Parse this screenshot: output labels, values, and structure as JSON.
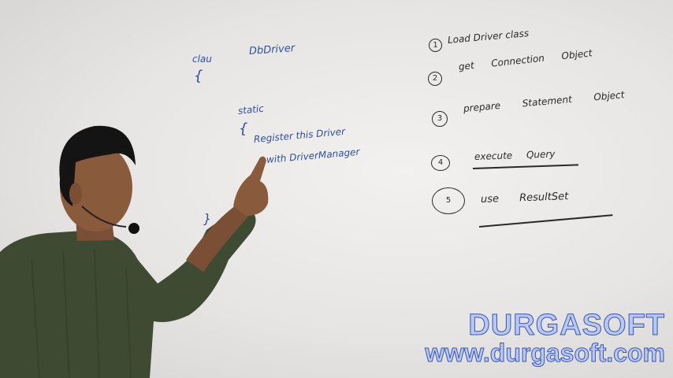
{
  "board": {
    "code": {
      "class_kw": "clau",
      "class_name": "DbDriver",
      "brace": "{",
      "static_kw": "static",
      "static_brace": "{",
      "line1": "Register this Driver",
      "line2": "with DriverManager",
      "closing": "}"
    },
    "steps": [
      {
        "num": "1",
        "text": "Load Driver class"
      },
      {
        "num": "2",
        "text": "get Connection Object"
      },
      {
        "num": "3",
        "text": "prepare Statement Object"
      },
      {
        "num": "4",
        "text": "execute Query"
      },
      {
        "num": "5",
        "text": "use ResultSet"
      }
    ]
  },
  "watermark": {
    "brand": "DURGASOFT",
    "url": "www.durgasoft.com"
  },
  "colors": {
    "marker_blue": "#2f4fa0",
    "marker_black": "#2a2a2a",
    "watermark_fill": "#b8c8f4"
  }
}
